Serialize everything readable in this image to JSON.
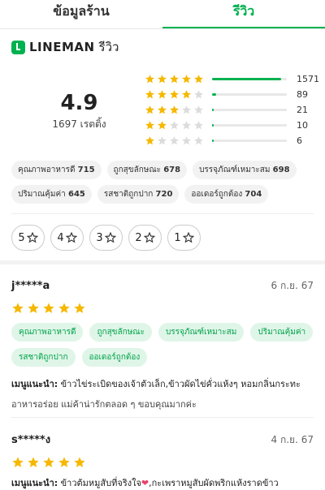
{
  "tabs": [
    {
      "label": "ข้อมูลร้าน"
    },
    {
      "label": "รีวิว"
    }
  ],
  "brand": {
    "name": "LINEMAN",
    "suffix": "รีวิว"
  },
  "summary": {
    "score": "4.9",
    "count_label": "1697 เรตติ้ง"
  },
  "distribution": [
    {
      "stars": 5,
      "count": "1571",
      "fraction": 0.926
    },
    {
      "stars": 4,
      "count": "89",
      "fraction": 0.052
    },
    {
      "stars": 3,
      "count": "21",
      "fraction": 0.012
    },
    {
      "stars": 2,
      "count": "10",
      "fraction": 0.006
    },
    {
      "stars": 1,
      "count": "6",
      "fraction": 0.004
    }
  ],
  "attributes": [
    {
      "label": "คุณภาพอาหารดี",
      "count": "715"
    },
    {
      "label": "ถูกสุขลักษณะ",
      "count": "678"
    },
    {
      "label": "บรรจุภัณฑ์เหมาะสม",
      "count": "698"
    },
    {
      "label": "ปริมาณคุ้มค่า",
      "count": "645"
    },
    {
      "label": "รสชาติถูกปาก",
      "count": "720"
    },
    {
      "label": "ออเดอร์ถูกต้อง",
      "count": "704"
    }
  ],
  "filters": [
    {
      "label": "5"
    },
    {
      "label": "4"
    },
    {
      "label": "3"
    },
    {
      "label": "2"
    },
    {
      "label": "1"
    }
  ],
  "reviews": [
    {
      "name": "j*****a",
      "date": "6 ก.ย. 67",
      "rating": 5,
      "tags": [
        "คุณภาพอาหารดี",
        "ถูกสุขลักษณะ",
        "บรรจุภัณฑ์เหมาะสม",
        "ปริมาณคุ้มค่า",
        "รสชาติถูกปาก",
        "ออเดอร์ถูกต้อง"
      ],
      "menu_label": "เมนูแนะนำ:",
      "menu_text": "ข้าวไข่ระเบิดของเจ้าตัวเล็ก,ข้าวผัดไข่คั่วแห้งๆ หอมกลิ่นกระทะ",
      "comment": "อาหารอร่อย แม่ค้าน่ารักตลอด ๆ ขอบคุณมากค่ะ"
    },
    {
      "name": "s*****ง",
      "date": "4 ก.ย. 67",
      "rating": 5,
      "menu_label": "เมนูแนะนำ:",
      "menu_text_a": "ข้าวต้มหมูสับที่จริงใจ",
      "heart": "❤",
      "menu_text_b": ",กะเพราหมูสับผัดพริกแห้งราดข้าว"
    }
  ],
  "colors": {
    "accent": "#00b14f",
    "star": "#f5b800",
    "star_empty": "#dcdcdc",
    "tag_bg": "#dff5e8"
  },
  "icons": {
    "star": "star-icon",
    "logo": "lineman-logo-icon"
  }
}
